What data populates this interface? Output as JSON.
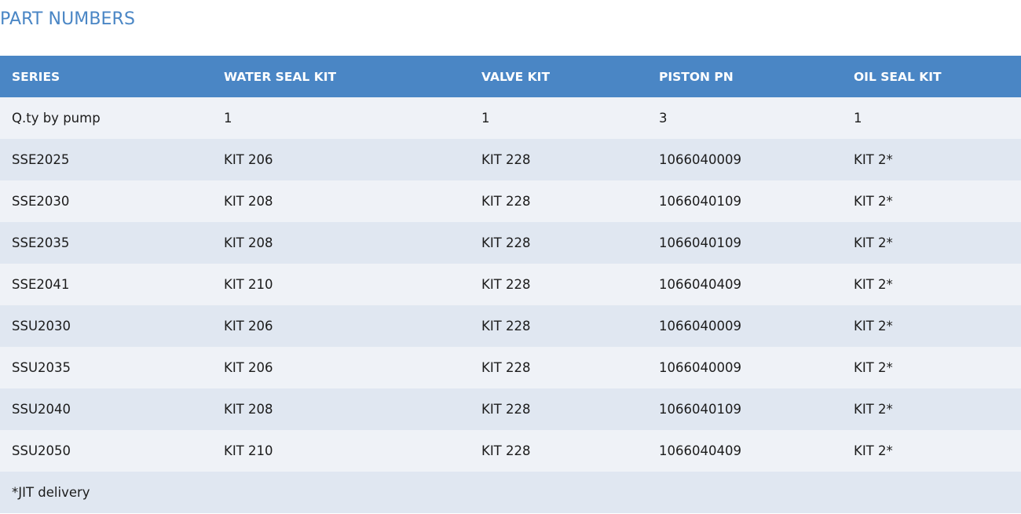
{
  "page": {
    "title": "PART NUMBERS"
  },
  "table": {
    "headers": [
      "SERIES",
      "WATER SEAL KIT",
      "VALVE KIT",
      "PISTON PN",
      "OIL SEAL KIT"
    ],
    "rows": [
      [
        "Q.ty by pump",
        "1",
        "1",
        "3",
        "1"
      ],
      [
        "SSE2025",
        "KIT 206",
        "KIT 228",
        "1066040009",
        "KIT 2*"
      ],
      [
        "SSE2030",
        "KIT 208",
        "KIT 228",
        "1066040109",
        "KIT 2*"
      ],
      [
        "SSE2035",
        "KIT 208",
        "KIT 228",
        "1066040109",
        "KIT 2*"
      ],
      [
        "SSE2041",
        "KIT 210",
        "KIT 228",
        "1066040409",
        "KIT 2*"
      ],
      [
        "SSU2030",
        "KIT 206",
        "KIT 228",
        "1066040009",
        "KIT 2*"
      ],
      [
        "SSU2035",
        "KIT 206",
        "KIT 228",
        "1066040009",
        "KIT 2*"
      ],
      [
        "SSU2040",
        "KIT 208",
        "KIT 228",
        "1066040109",
        "KIT 2*"
      ],
      [
        "SSU2050",
        "KIT 210",
        "KIT 228",
        "1066040409",
        "KIT 2*"
      ]
    ],
    "footnote": "*JIT delivery"
  },
  "colors": {
    "accent": "#4a86c5",
    "row_light": "#eff2f7",
    "row_dark": "#e0e7f1"
  }
}
